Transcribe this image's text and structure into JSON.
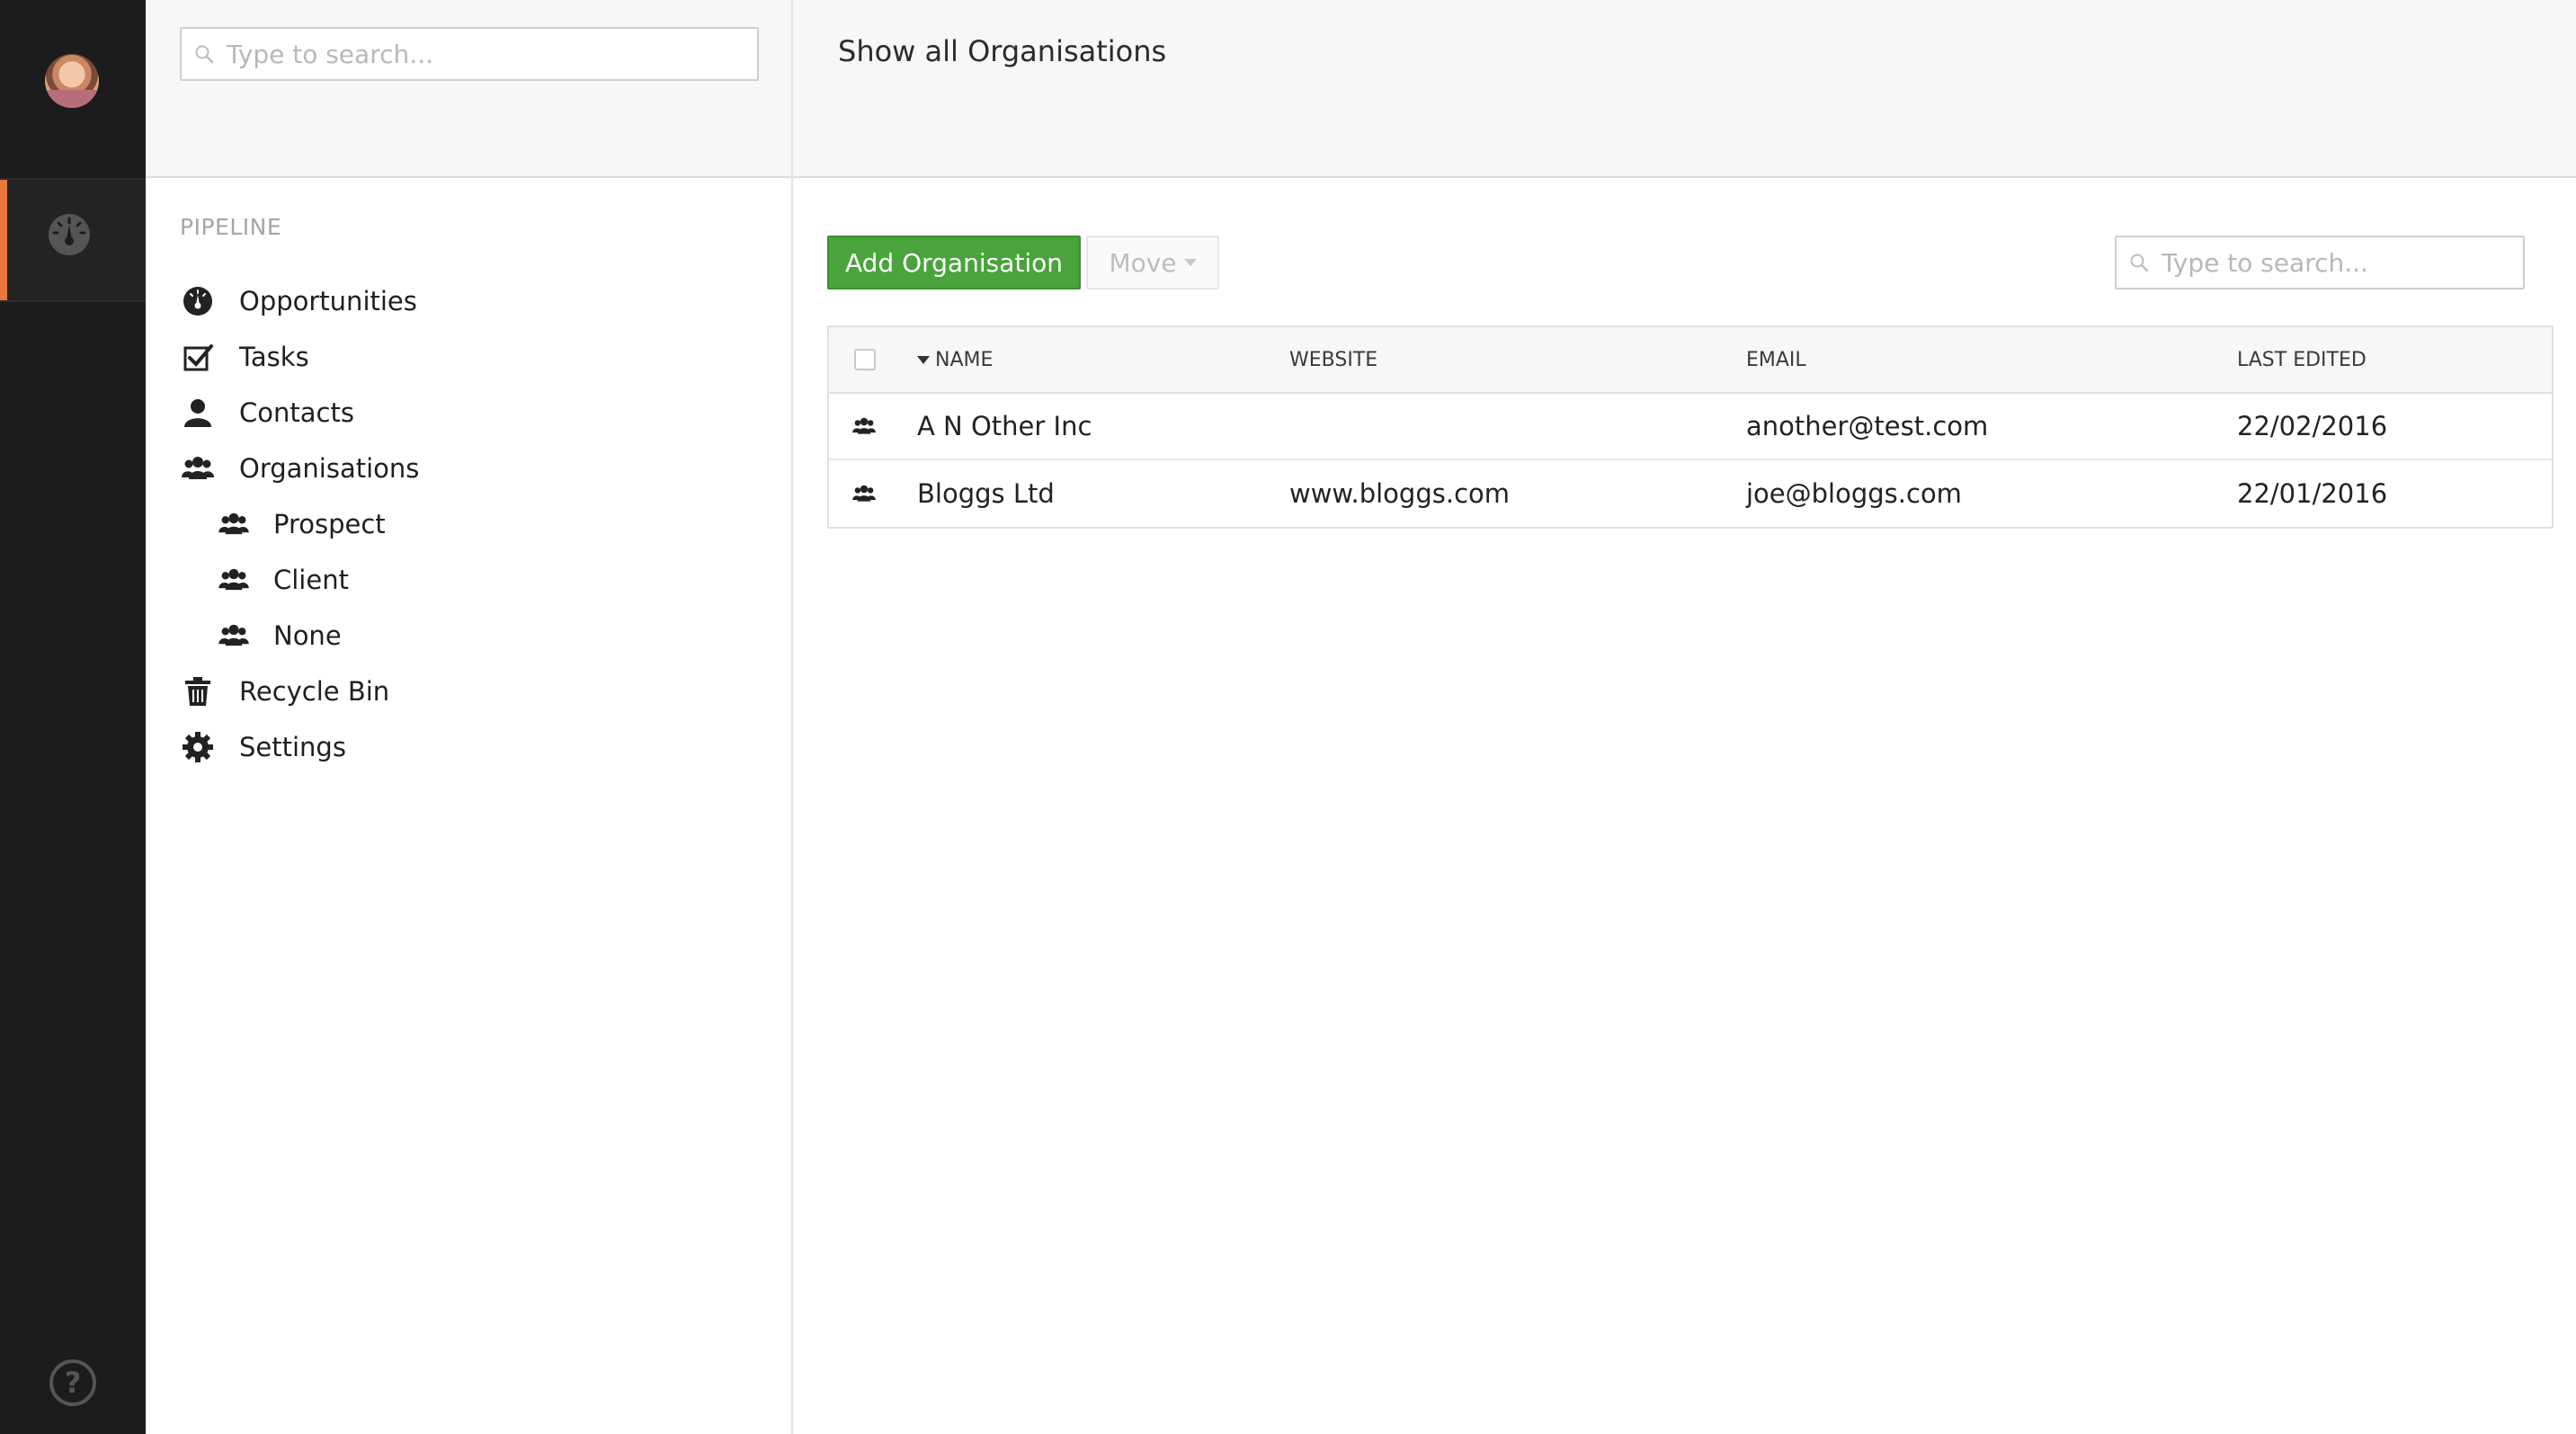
{
  "sidebar": {
    "search_placeholder": "Type to search...",
    "section_title": "PIPELINE",
    "items": [
      {
        "label": "Opportunities",
        "icon": "gauge-icon"
      },
      {
        "label": "Tasks",
        "icon": "checkbox-icon"
      },
      {
        "label": "Contacts",
        "icon": "person-icon"
      },
      {
        "label": "Organisations",
        "icon": "group-icon"
      },
      {
        "label": "Prospect",
        "icon": "group-icon"
      },
      {
        "label": "Client",
        "icon": "group-icon"
      },
      {
        "label": "None",
        "icon": "group-icon"
      },
      {
        "label": "Recycle Bin",
        "icon": "trash-icon"
      },
      {
        "label": "Settings",
        "icon": "gear-icon"
      }
    ]
  },
  "rail": {
    "help_label": "?"
  },
  "main": {
    "title": "Show all Organisations",
    "add_button": "Add Organisation",
    "move_button": "Move",
    "search_placeholder": "Type to search...",
    "table": {
      "headers": {
        "name": "NAME",
        "website": "WEBSITE",
        "email": "EMAIL",
        "last_edited": "LAST EDITED"
      },
      "rows": [
        {
          "name": "A N Other Inc",
          "website": "",
          "email": "another@test.com",
          "last_edited": "22/02/2016"
        },
        {
          "name": "Bloggs Ltd",
          "website": "www.bloggs.com",
          "email": "joe@bloggs.com",
          "last_edited": "22/01/2016"
        }
      ]
    }
  },
  "colors": {
    "accent": "#e7773a",
    "primary_button": "#4aa33c",
    "rail": "#1c1c1c"
  }
}
